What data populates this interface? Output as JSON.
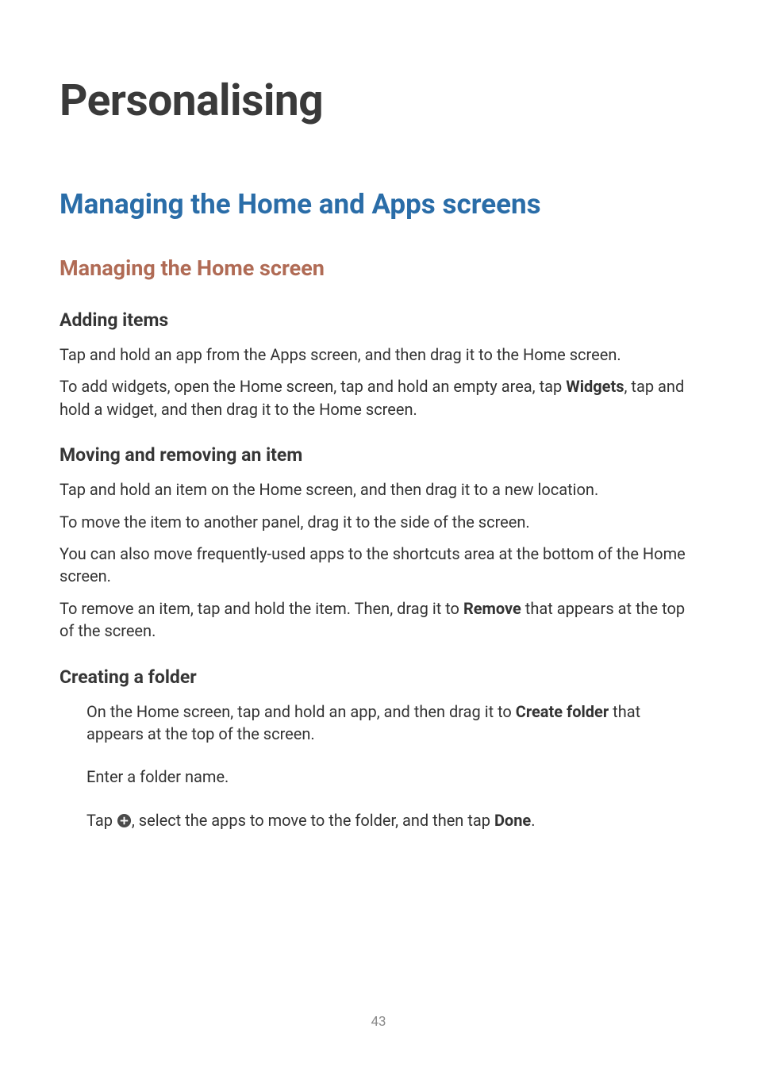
{
  "title": "Personalising",
  "section": "Managing the Home and Apps screens",
  "subsection": "Managing the Home screen",
  "adding": {
    "heading": "Adding items",
    "p1": "Tap and hold an app from the Apps screen, and then drag it to the Home screen.",
    "p2a": "To add widgets, open the Home screen, tap and hold an empty area, tap ",
    "p2b": "Widgets",
    "p2c": ", tap and hold a widget, and then drag it to the Home screen."
  },
  "moving": {
    "heading": "Moving and removing an item",
    "p1": "Tap and hold an item on the Home screen, and then drag it to a new location.",
    "p2": "To move the item to another panel, drag it to the side of the screen.",
    "p3": "You can also move frequently-used apps to the shortcuts area at the bottom of the Home screen.",
    "p4a": "To remove an item, tap and hold the item. Then, drag it to ",
    "p4b": "Remove",
    "p4c": " that appears at the top of the screen."
  },
  "folder": {
    "heading": "Creating a folder",
    "p1a": "On the Home screen, tap and hold an app, and then drag it to ",
    "p1b": "Create folder",
    "p1c": " that appears at the top of the screen.",
    "p2": "Enter a folder name.",
    "p3a": "Tap ",
    "p3b": ", select the apps to move to the folder, and then tap ",
    "p3c": "Done",
    "p3d": "."
  },
  "page_number": "43"
}
